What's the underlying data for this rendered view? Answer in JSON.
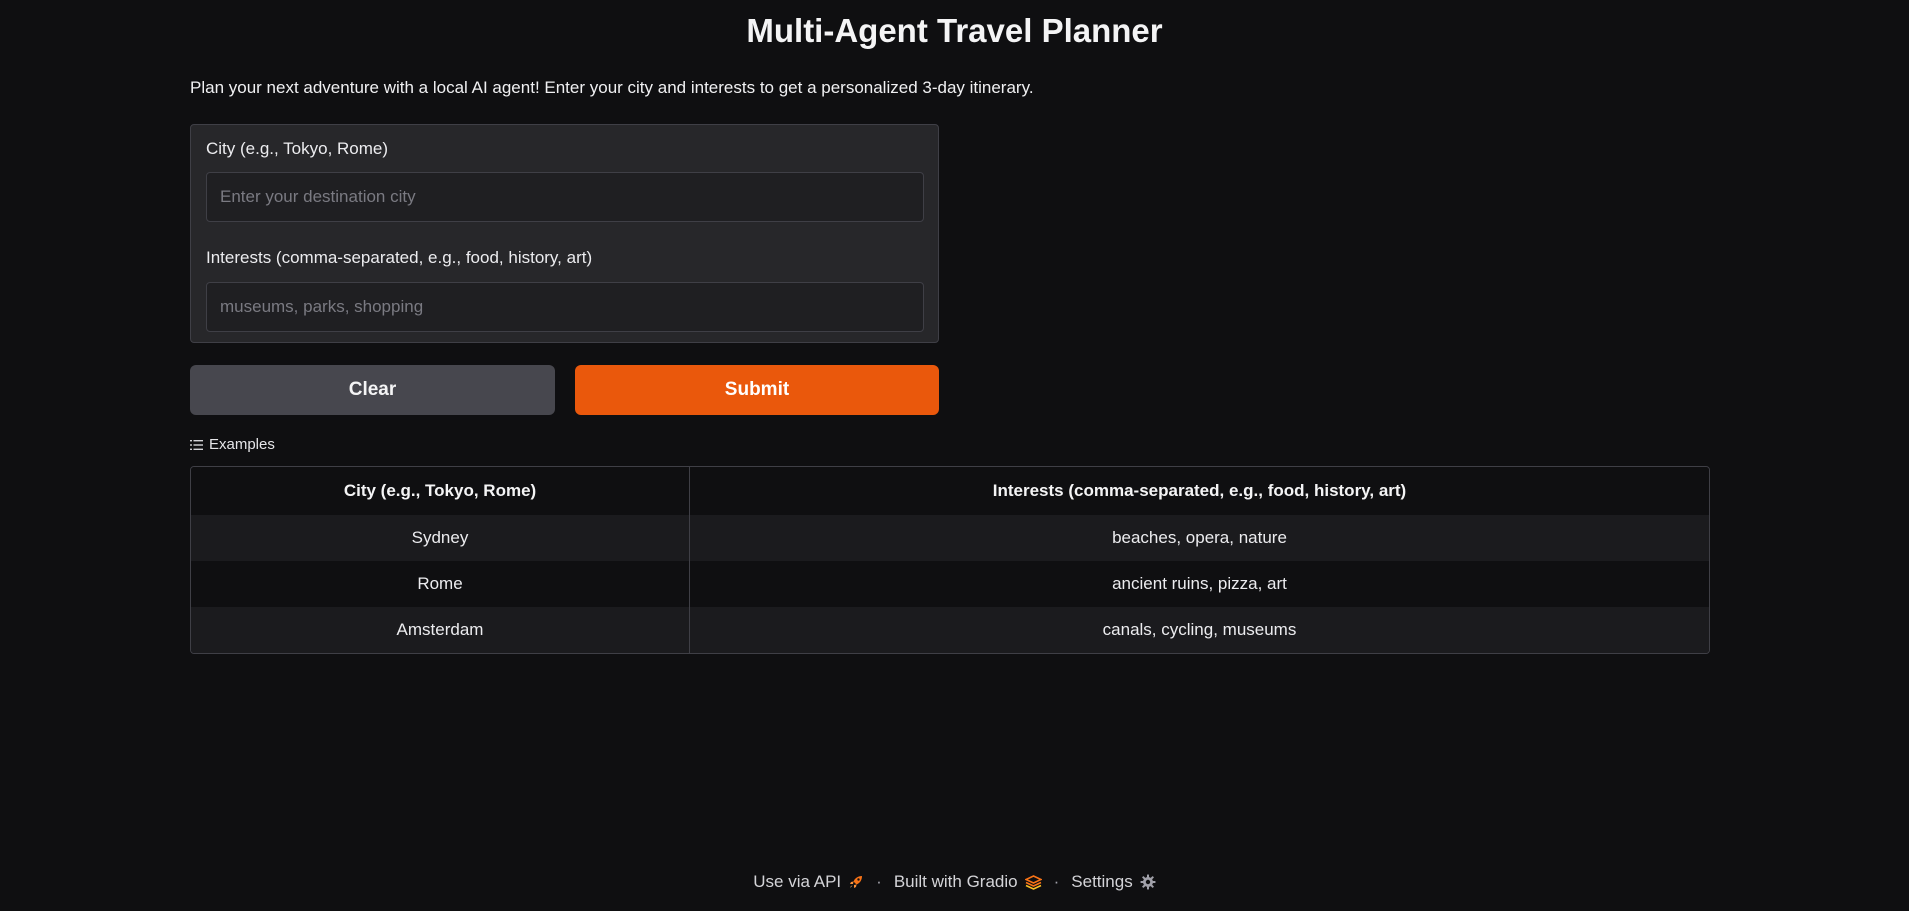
{
  "app": {
    "title": "Multi-Agent Travel Planner",
    "description": "Plan your next adventure with a local AI agent! Enter your city and interests to get a personalized 3-day itinerary."
  },
  "form": {
    "city": {
      "label": "City (e.g., Tokyo, Rome)",
      "value": "",
      "placeholder": "Enter your destination city"
    },
    "interests": {
      "label": "Interests (comma-separated, e.g., food, history, art)",
      "value": "",
      "placeholder": "museums, parks, shopping"
    }
  },
  "buttons": {
    "clear_label": "Clear",
    "submit_label": "Submit"
  },
  "examples": {
    "heading": "Examples",
    "headers": [
      "City (e.g., Tokyo, Rome)",
      "Interests (comma-separated, e.g., food, history, art)"
    ],
    "rows": [
      [
        "Sydney",
        "beaches, opera, nature"
      ],
      [
        "Rome",
        "ancient ruins, pizza, art"
      ],
      [
        "Amsterdam",
        "canals, cycling, museums"
      ]
    ]
  },
  "footer": {
    "api_label": "Use via API",
    "api_icon": "rocket-icon",
    "built_label": "Built with Gradio",
    "built_icon": "gradio-logo-icon",
    "settings_label": "Settings",
    "settings_icon": "gear-icon",
    "separator": "·"
  },
  "colors": {
    "background": "#0f0f11",
    "panel": "#27272a",
    "accent": "#ea580c",
    "secondary_button": "#47474e"
  }
}
